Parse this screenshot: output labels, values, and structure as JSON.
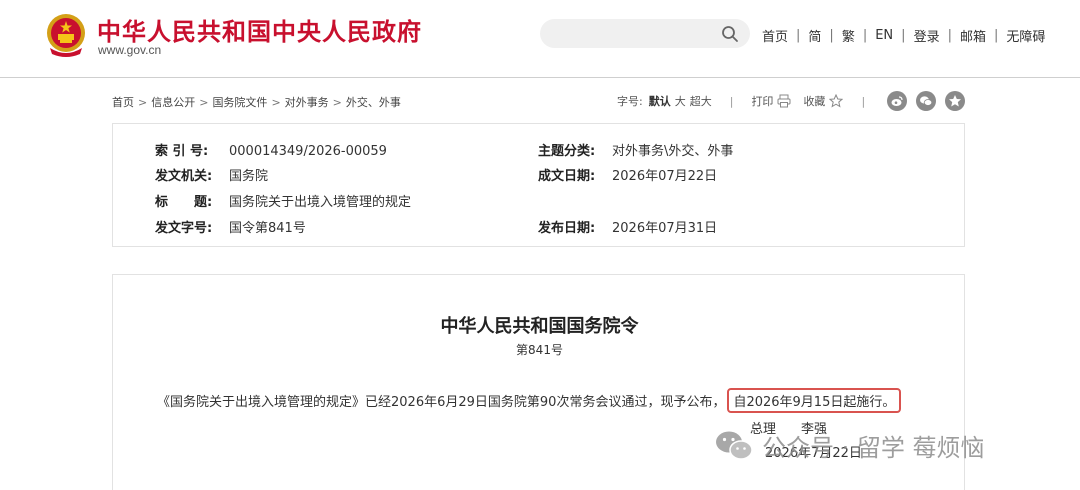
{
  "header": {
    "site_title": "中华人民共和国中央人民政府",
    "site_url": "www.gov.cn",
    "search_placeholder": "",
    "nav": [
      "首页",
      "简",
      "繁",
      "EN",
      "登录",
      "邮箱",
      "无障碍"
    ]
  },
  "breadcrumb": [
    "首页",
    "信息公开",
    "国务院文件",
    "对外事务",
    "外交、外事"
  ],
  "tools": {
    "font_size_label": "字号:",
    "font_default": "默认",
    "font_large": "大",
    "font_xlarge": "超大",
    "print_label": "打印",
    "favorite_label": "收藏"
  },
  "meta": {
    "index_label": "索 引 号:",
    "index_value": "000014349/2026-00059",
    "category_label": "主题分类:",
    "category_value": "对外事务\\外交、外事",
    "issuer_label": "发文机关:",
    "issuer_value": "国务院",
    "written_date_label": "成文日期:",
    "written_date_value": "2026年07月22日",
    "title_label": "标　　题:",
    "title_value": "国务院关于出境入境管理的规定",
    "doc_no_label": "发文字号:",
    "doc_no_value": "国令第841号",
    "publish_date_label": "发布日期:",
    "publish_date_value": "2026年07月31日"
  },
  "document": {
    "title": "中华人民共和国国务院令",
    "number": "第841号",
    "body_text": "《国务院关于出境入境管理的规定》已经2026年6月29日国务院第90次常务会议通过，现予公布，",
    "highlighted_text": "自2026年9月15日起施行。",
    "signer_title": "总理",
    "signer_name": "李强",
    "sign_date": "2026年7月22日"
  },
  "watermark": {
    "text": "公众号 · 留学 莓烦恼"
  },
  "colors": {
    "brand_red": "#c8102e",
    "highlight_border": "#d9534f"
  }
}
